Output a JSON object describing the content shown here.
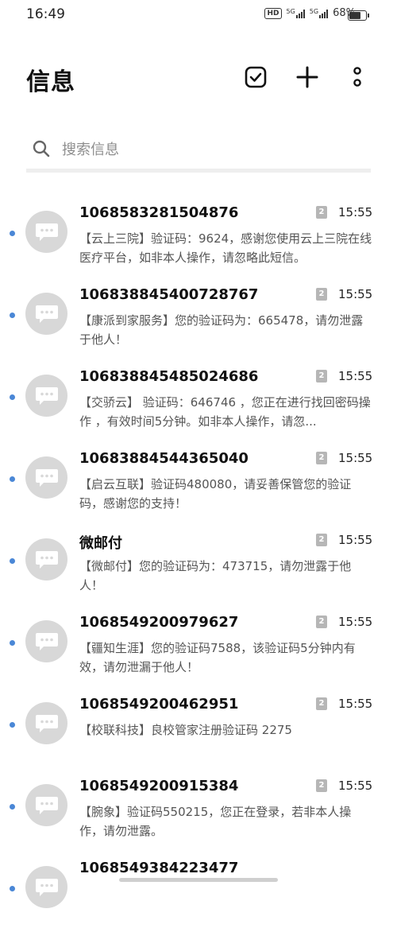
{
  "status_bar": {
    "time": "16:49",
    "hd_label": "HD",
    "sim1_label": "5G",
    "sim2_label": "5G",
    "battery_percent": "68%"
  },
  "header": {
    "title": "信息"
  },
  "search": {
    "placeholder": "搜索信息"
  },
  "messages": [
    {
      "sender": "1068583281504876",
      "sim": "2",
      "time": "15:55",
      "snippet": "【云上三院】验证码：9624，感谢您使用云上三院在线医疗平台，如非本人操作，请忽略此短信。"
    },
    {
      "sender": "106838845400728767",
      "sim": "2",
      "time": "15:55",
      "snippet": "【康派到家服务】您的验证码为：665478，请勿泄露于他人！"
    },
    {
      "sender": "106838845485024686",
      "sim": "2",
      "time": "15:55",
      "snippet": "【交骄云】 验证码：646746 ，您正在进行找回密码操作 ，有效时间5分钟。如非本人操作，请忽..."
    },
    {
      "sender": "10683884544365040",
      "sim": "2",
      "time": "15:55",
      "snippet": "【启云互联】验证码480080，请妥善保管您的验证码，感谢您的支持！"
    },
    {
      "sender": "微邮付",
      "sim": "2",
      "time": "15:55",
      "snippet": "【微邮付】您的验证码为：473715，请勿泄露于他人！"
    },
    {
      "sender": "1068549200979627",
      "sim": "2",
      "time": "15:55",
      "snippet": "【疆知生涯】您的验证码7588，该验证码5分钟内有效，请勿泄漏于他人！"
    },
    {
      "sender": "1068549200462951",
      "sim": "2",
      "time": "15:55",
      "snippet": "【校联科技】良校管家注册验证码 2275"
    },
    {
      "sender": "1068549200915384",
      "sim": "2",
      "time": "15:55",
      "snippet": "【腕象】验证码550215，您正在登录，若非本人操作，请勿泄露。"
    },
    {
      "sender": "1068549384223477",
      "sim": "",
      "time": "",
      "snippet": ""
    }
  ]
}
